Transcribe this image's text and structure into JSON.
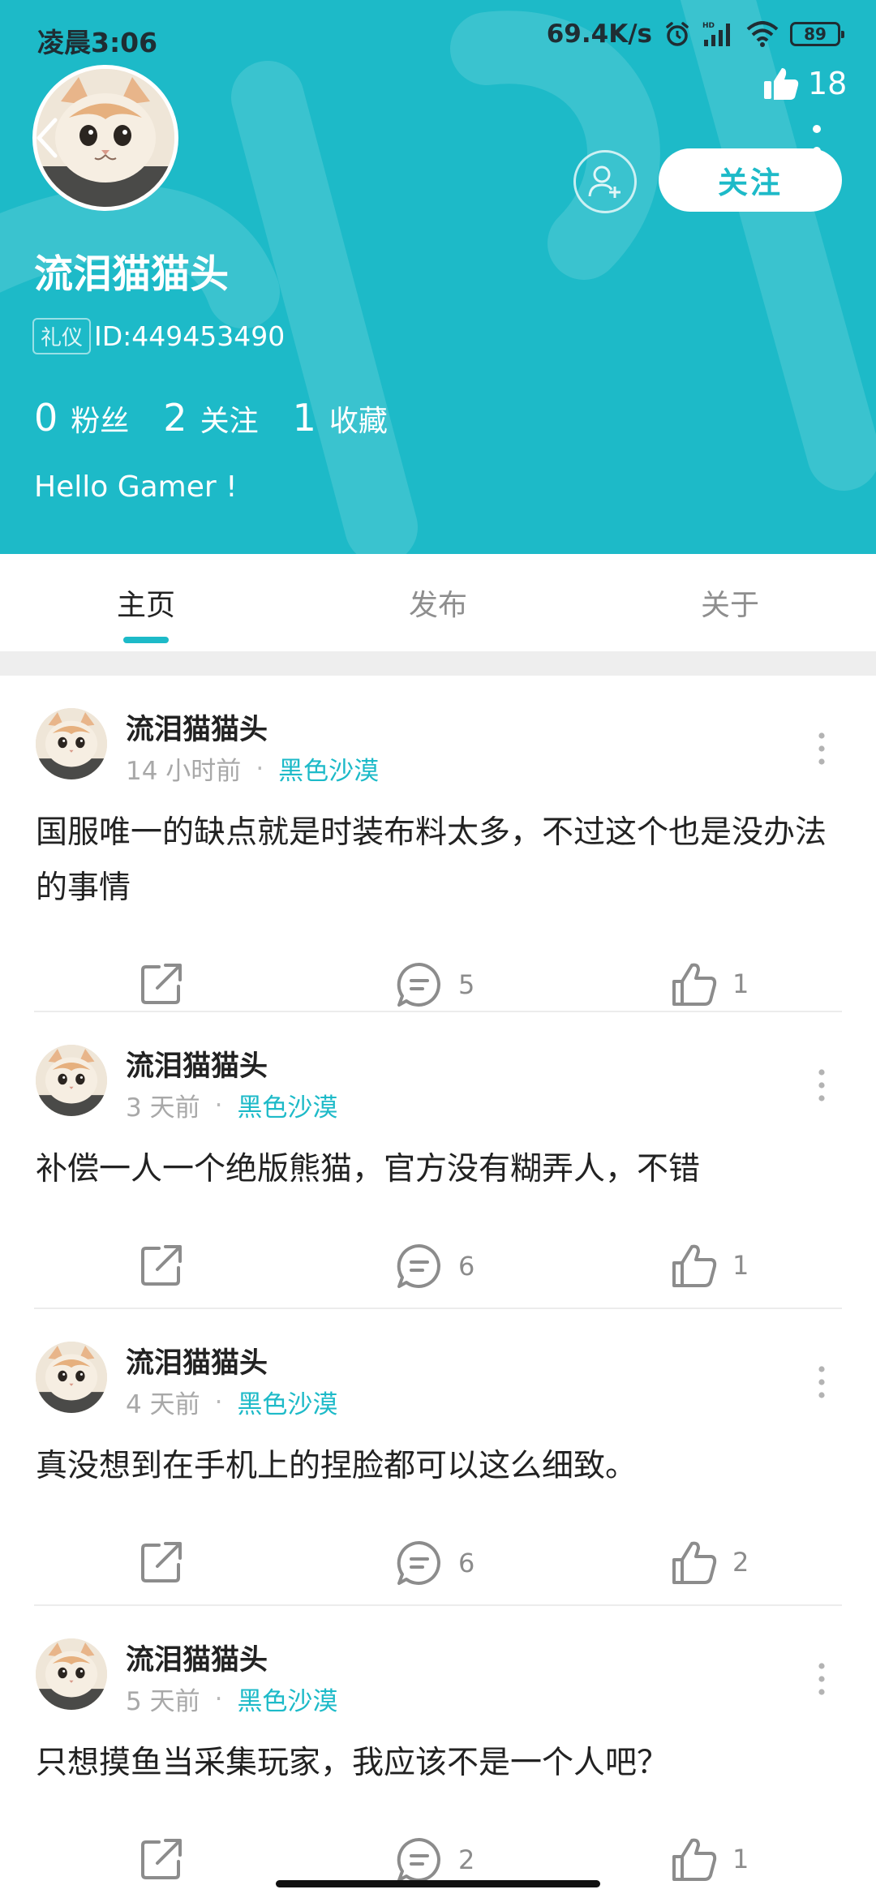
{
  "status_bar": {
    "time": "凌晨3:06",
    "network_speed": "69.4K/s",
    "battery": "89",
    "icons": [
      "alarm-icon",
      "hd-signal-icon",
      "wifi-icon",
      "battery-icon"
    ]
  },
  "profile": {
    "likes_count": "18",
    "follow_label": "关注",
    "username": "流泪猫猫头",
    "badge": "礼仪",
    "id_text": "ID:449453490",
    "stats": [
      {
        "num": "0",
        "label": "粉丝"
      },
      {
        "num": "2",
        "label": "关注"
      },
      {
        "num": "1",
        "label": "收藏"
      }
    ],
    "bio": "Hello Gamer !"
  },
  "tabs": [
    {
      "label": "主页",
      "active": true
    },
    {
      "label": "发布",
      "active": false
    },
    {
      "label": "关于",
      "active": false
    }
  ],
  "posts": [
    {
      "author": "流泪猫猫头",
      "time": "14 小时前",
      "dot": "·",
      "tag": "黑色沙漠",
      "text": "国服唯一的缺点就是时装布料太多，不过这个也是没办法的事情",
      "comments": "5",
      "likes": "1"
    },
    {
      "author": "流泪猫猫头",
      "time": "3 天前",
      "dot": "·",
      "tag": "黑色沙漠",
      "text": "补偿一人一个绝版熊猫，官方没有糊弄人，不错",
      "comments": "6",
      "likes": "1"
    },
    {
      "author": "流泪猫猫头",
      "time": "4 天前",
      "dot": "·",
      "tag": "黑色沙漠",
      "text": "真没想到在手机上的捏脸都可以这么细致。",
      "comments": "6",
      "likes": "2"
    },
    {
      "author": "流泪猫猫头",
      "time": "5 天前",
      "dot": "·",
      "tag": "黑色沙漠",
      "text": "只想摸鱼当采集玩家，我应该不是一个人吧？",
      "comments": "2",
      "likes": "1"
    }
  ],
  "colors": {
    "accent": "#1dbac8",
    "header_bg": "#1dbac8",
    "text_primary": "#222222",
    "text_secondary": "#a8a8a8",
    "divider": "#ececec"
  }
}
